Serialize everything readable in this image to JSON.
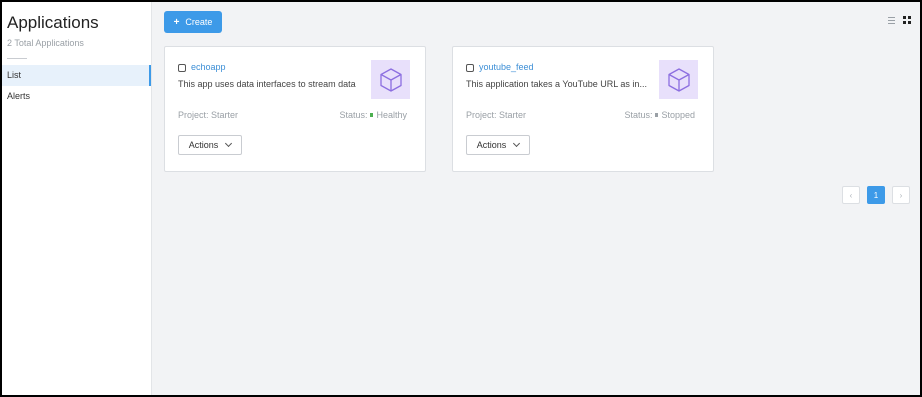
{
  "sidebar": {
    "title": "Applications",
    "subtitle": "2 Total Applications",
    "items": [
      {
        "label": "List",
        "active": true
      },
      {
        "label": "Alerts",
        "active": false
      }
    ]
  },
  "toolbar": {
    "create_label": "Create",
    "create_icon": "+",
    "view_modes": [
      "list-view-icon",
      "grid-view-icon"
    ]
  },
  "apps": [
    {
      "name": "echoapp",
      "description": "This app uses data interfaces to stream data",
      "project_label": "Project:",
      "project": "Starter",
      "status_label": "Status:",
      "status": "Healthy",
      "status_color": "#4caf50",
      "actions_label": "Actions",
      "icon": "cube-icon"
    },
    {
      "name": "youtube_feed",
      "description": "This application takes a YouTube URL as in...",
      "project_label": "Project:",
      "project": "Starter",
      "status_label": "Status:",
      "status": "Stopped",
      "status_color": "#9aa0a6",
      "actions_label": "Actions",
      "icon": "cube-icon"
    }
  ],
  "pagination": {
    "prev": "‹",
    "current": "1",
    "next": "›"
  },
  "colors": {
    "accent": "#3d9ae8",
    "thumb_bg": "#e8e0fb",
    "cube_stroke": "#8c6fe0"
  }
}
